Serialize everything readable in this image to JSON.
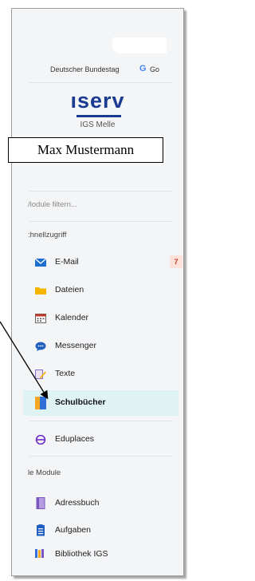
{
  "bookmarks": {
    "item1": "Deutscher Bundestag",
    "item2": "Go"
  },
  "brand": {
    "logo_text": "ıserv",
    "school_name": "IGS Melle"
  },
  "user_box": {
    "name": "Max Mustermann"
  },
  "sidebar": {
    "filter_placeholder": "/lodule filtern...",
    "quick_access_label": ":hnellzugriff",
    "quick_items": [
      {
        "label": "E-Mail",
        "icon": "mail-icon",
        "badge": "7"
      },
      {
        "label": "Dateien",
        "icon": "folder-icon"
      },
      {
        "label": "Kalender",
        "icon": "calendar-icon"
      },
      {
        "label": "Messenger",
        "icon": "messenger-icon"
      },
      {
        "label": "Texte",
        "icon": "text-edit-icon"
      },
      {
        "label": "Schulbücher",
        "icon": "book-icon",
        "active": true
      },
      {
        "label": "Eduplaces",
        "icon": "eduplaces-icon"
      }
    ],
    "all_modules_label": "le Module",
    "all_items": [
      {
        "label": "Adressbuch",
        "icon": "address-book-icon"
      },
      {
        "label": "Aufgaben",
        "icon": "tasks-icon"
      },
      {
        "label": "Bibliothek IGS",
        "icon": "library-icon"
      }
    ]
  },
  "colors": {
    "accent": "#1b3b93",
    "active_bg": "#dff3f5",
    "badge_bg": "#fde2dc",
    "badge_fg": "#c0392b"
  }
}
